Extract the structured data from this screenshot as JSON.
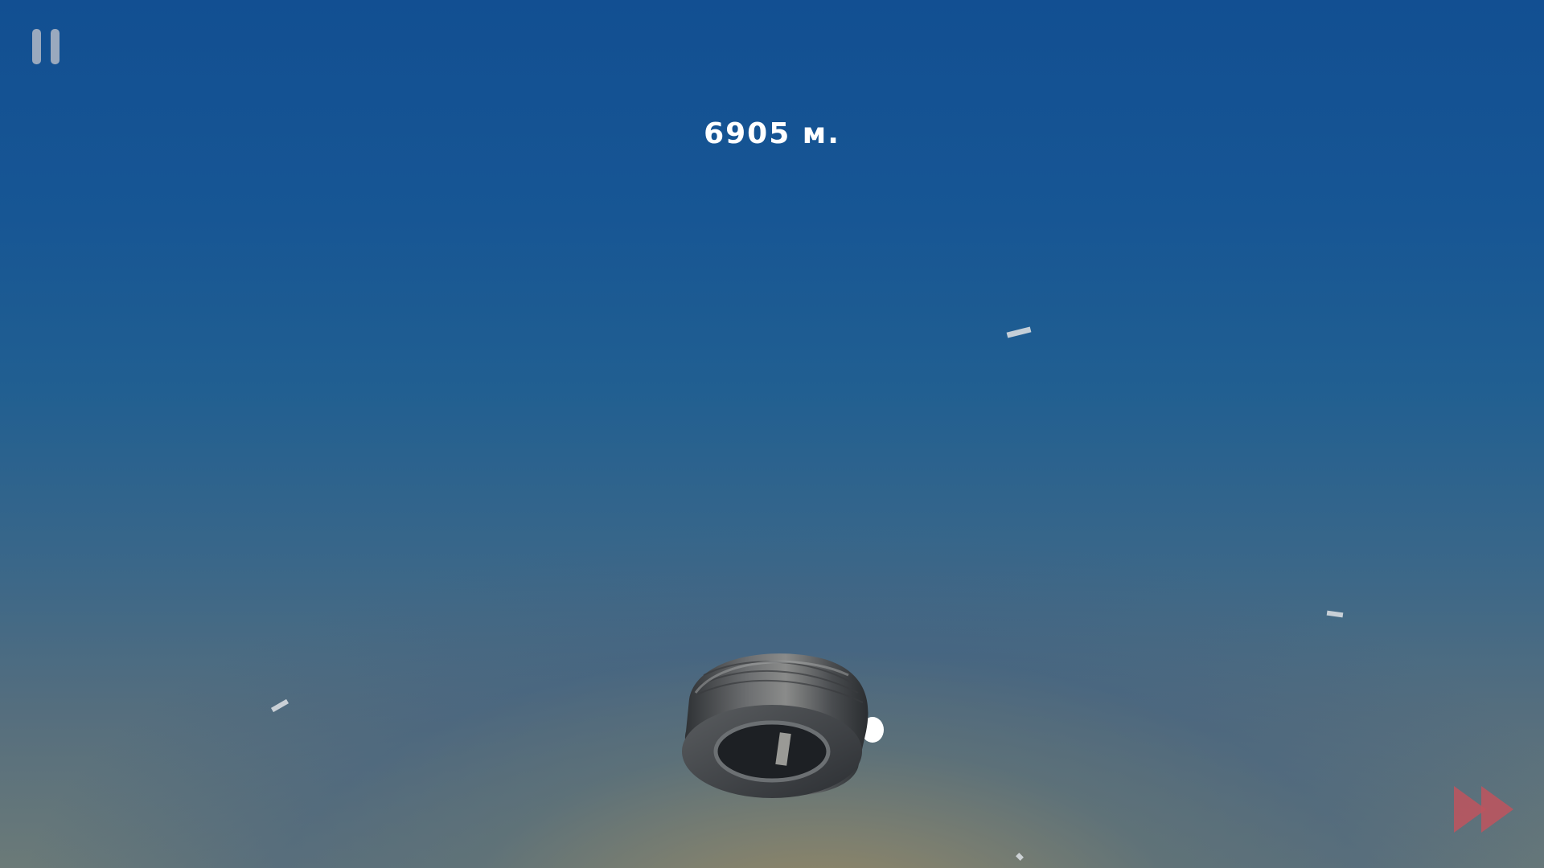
{
  "hud": {
    "distance_text": "6905 м.",
    "pause_icon": "pause-icon",
    "skip_icon": "fast-forward-icon"
  },
  "colors": {
    "sky_top": "#124f92",
    "horizon_glow": "#9c8a60",
    "pause": "#9aa9be",
    "skip": "#c0545e"
  }
}
